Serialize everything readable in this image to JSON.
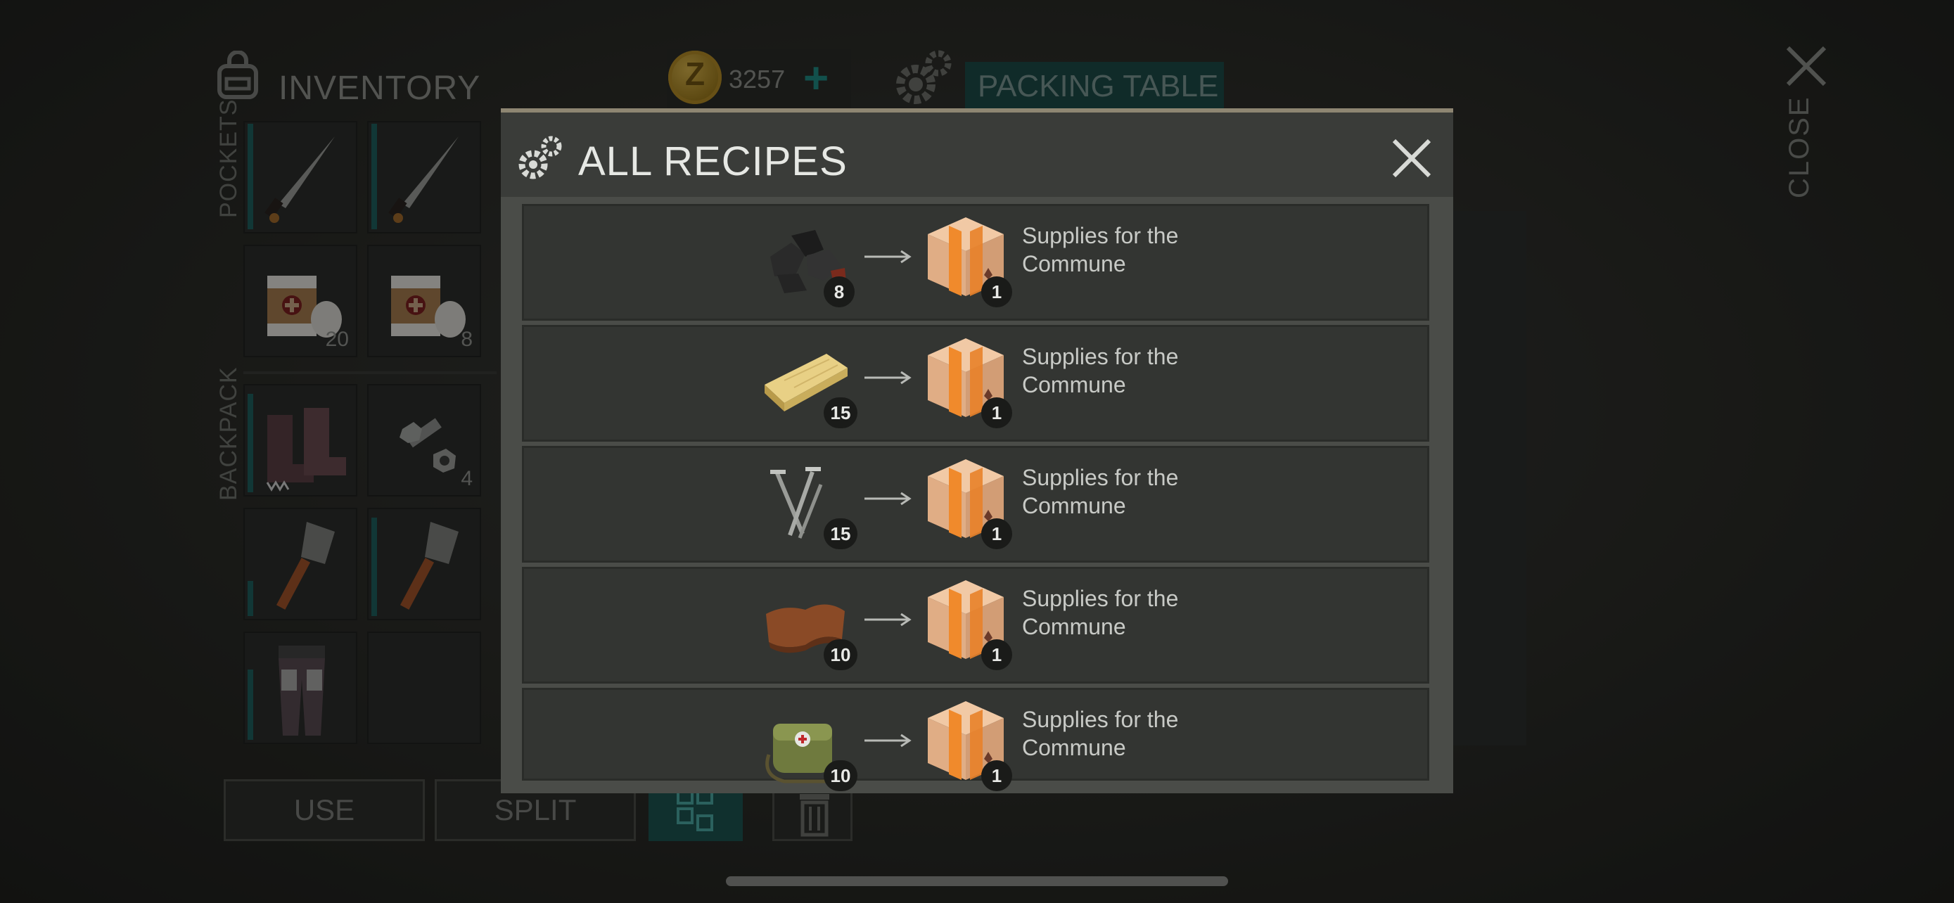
{
  "inventory": {
    "title": "INVENTORY",
    "section_pockets": "POCKETS",
    "section_backpack": "BACKPACK",
    "pocket_slots": [
      {
        "item": "machete-icon",
        "qty": ""
      },
      {
        "item": "machete-icon",
        "qty": ""
      },
      {
        "item": "bandage-icon",
        "qty": "20"
      },
      {
        "item": "bandage-icon",
        "qty": "8"
      }
    ],
    "backpack_slots": [
      {
        "item": "spiked-boots-icon",
        "qty": ""
      },
      {
        "item": "bolt-nut-icon",
        "qty": "4"
      },
      {
        "item": "shovel-icon",
        "qty": ""
      },
      {
        "item": "shovel-icon",
        "qty": ""
      },
      {
        "item": "armored-pants-icon",
        "qty": ""
      },
      {
        "item": "",
        "qty": ""
      }
    ]
  },
  "currency": {
    "amount": "3257",
    "add_label": "+",
    "coin_letter": "Z"
  },
  "station": {
    "label": "PACKING TABLE"
  },
  "close": {
    "label": "CLOSE"
  },
  "actions": {
    "use_label": "USE",
    "split_label": "SPLIT"
  },
  "modal": {
    "title": "ALL RECIPES",
    "recipes": [
      {
        "input_icon": "coal-icon",
        "input_qty": "8",
        "output_icon": "cardboard-box-icon",
        "output_qty": "1",
        "output_name": "Supplies for the Commune"
      },
      {
        "input_icon": "wood-plank-icon",
        "input_qty": "15",
        "output_icon": "cardboard-box-icon",
        "output_qty": "1",
        "output_name": "Supplies for the Commune"
      },
      {
        "input_icon": "nails-icon",
        "input_qty": "15",
        "output_icon": "cardboard-box-icon",
        "output_qty": "1",
        "output_name": "Supplies for the Commune"
      },
      {
        "input_icon": "leather-icon",
        "input_qty": "10",
        "output_icon": "cardboard-box-icon",
        "output_qty": "1",
        "output_name": "Supplies for the Commune"
      },
      {
        "input_icon": "medical-bag-icon",
        "input_qty": "10",
        "output_icon": "cardboard-box-icon",
        "output_qty": "1",
        "output_name": "Supplies for the Commune"
      }
    ]
  },
  "colors": {
    "accent_teal": "#1f8a84",
    "modal_bg": "#4a4c48",
    "row_bg": "#333532",
    "coin_gold": "#c9a63e"
  }
}
